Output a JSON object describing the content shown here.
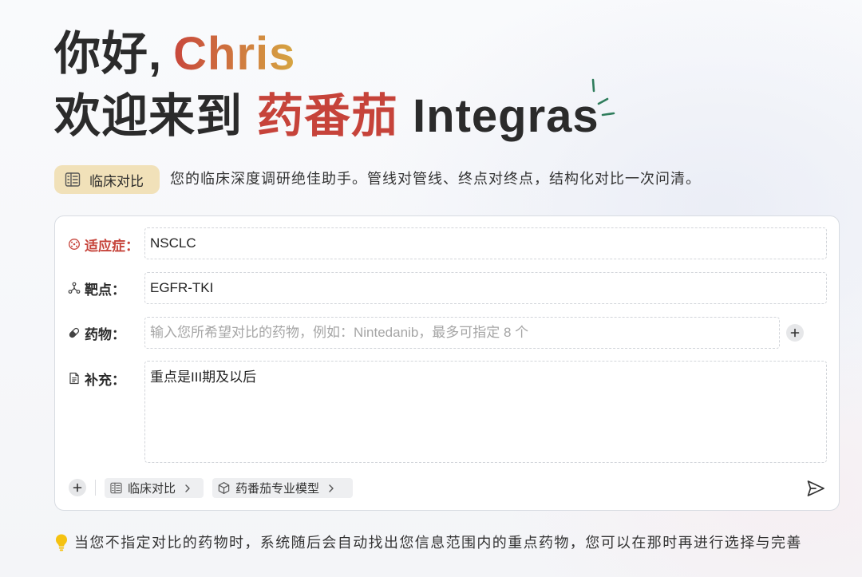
{
  "greeting": {
    "prefix": "你好,",
    "name": "Chris"
  },
  "welcome": {
    "prefix": "欢迎来到",
    "brand": "药番茄",
    "product": "Integras"
  },
  "mode_badge": {
    "label": "临床对比",
    "icon": "book-list-icon"
  },
  "tagline": "您的临床深度调研绝佳助手。管线对管线、终点对终点，结构化对比一次问清。",
  "form": {
    "indication": {
      "icon": "virus-icon",
      "label": "适应症：",
      "value": "NSCLC",
      "required": true
    },
    "target": {
      "icon": "molecule-icon",
      "label": "靶点：",
      "value": "EGFR-TKI"
    },
    "drug": {
      "icon": "pill-icon",
      "label": "药物：",
      "value": "",
      "placeholder": "输入您所希望对比的药物，例如：Nintedanib，最多可指定 8 个",
      "add_icon": "plus-icon"
    },
    "supplement": {
      "icon": "document-icon",
      "label": "补充：",
      "value": "重点是III期及以后"
    }
  },
  "toolbar": {
    "attach_icon": "plus-icon",
    "mode_chip": {
      "icon": "book-list-icon",
      "label": "临床对比"
    },
    "model_chip": {
      "icon": "cube-icon",
      "label": "药番茄专业模型"
    },
    "send_icon": "send-icon"
  },
  "tip": {
    "icon": "lightbulb-icon",
    "text": "当您不指定对比的药物时，系统随后会自动找出您信息范围内的重点药物，您可以在那时再进行选择与完善"
  },
  "colors": {
    "accent_red": "#c6433a",
    "name_gradient_start": "#c8473c",
    "name_gradient_end": "#d6a642",
    "badge_bg": "#f1e1b9",
    "sparkle_green": "#2f7d5c",
    "bulb_yellow": "#f5c211"
  }
}
